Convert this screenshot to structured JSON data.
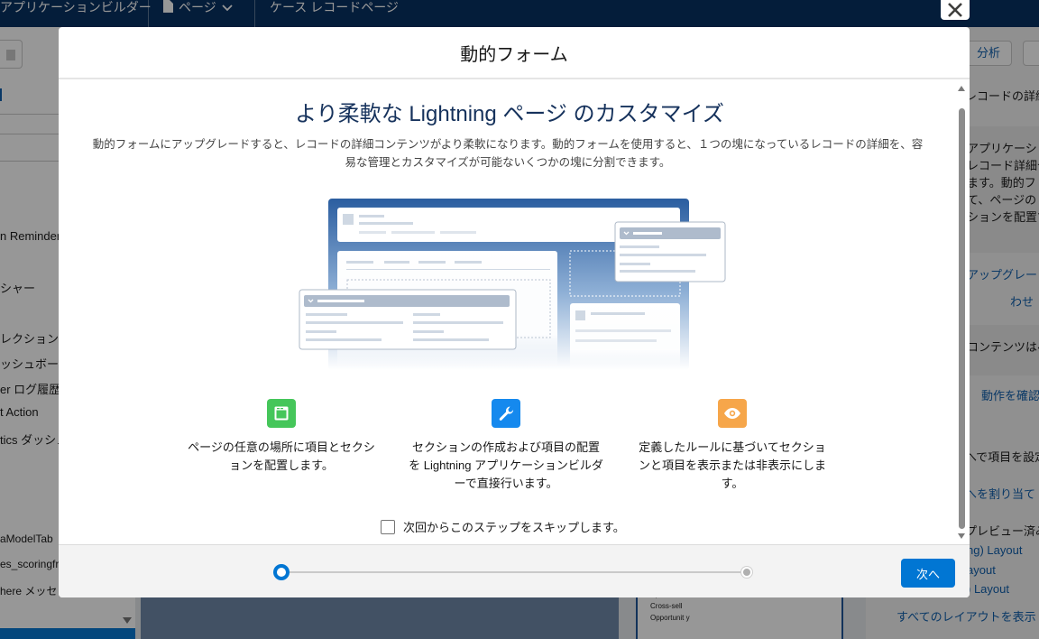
{
  "topbar": {
    "app_builder": "アプリケーションビルダー",
    "page_menu": "ページ",
    "page_name": "ケース レコードページ"
  },
  "left_panel": {
    "items": [
      "n Reminder",
      "シャー",
      "レクション",
      "ッシュボー",
      "er ログ履歴",
      "t Action",
      "tics ダッシュ",
      "aModelTab",
      "es_scoringfr",
      "here メッセ"
    ]
  },
  "right_panel": {
    "analyze_button": "分析",
    "record_detail": "レコードの詳細",
    "desc_lines": [
      "アプリケーシ",
      "レコード詳細セ",
      "ます。動的フ",
      "て、ページの",
      "ションを配置で"
    ],
    "upgrade_link": "アップグレードに関",
    "wase": "わせ",
    "content_text": "コンテンツはペー",
    "check_action": "動作を確認",
    "field_set": "へで項目を設定",
    "assign": "へを割り当て",
    "preview": "プレビュー済み",
    "layout1": "ng) Layout",
    "layout2": "ayout",
    "layout3": ") Layout",
    "all_layouts": "すべてのレイアウトを表示"
  },
  "canvas": {
    "card_text": "Up-sell / Cross-sell Opportunit y"
  },
  "modal": {
    "title": "動的フォーム",
    "headline": "より柔軟な Lightning ページ のカスタマイズ",
    "description": "動的フォームにアップグレードすると、レコードの詳細コンテンツがより柔軟になります。動的フォームを使用すると、１つの塊になっているレコードの詳細を、容易な管理とカスタマイズが可能ないくつかの塊に分割できます。",
    "features": [
      {
        "icon": "layout-icon",
        "color": "#45c65a",
        "text": "ページの任意の場所に項目とセクションを配置します。"
      },
      {
        "icon": "wrench-icon",
        "color": "#1589ee",
        "text": "セクションの作成および項目の配置を Lightning アプリケーションビルダーで直接行います。"
      },
      {
        "icon": "eye-icon",
        "color": "#f6a64a",
        "text": "定義したルールに基づいてセクションと項目を表示または非表示にします。"
      }
    ],
    "skip_label": "次回からこのステップをスキップします。",
    "skip_checked": false,
    "next_button": "次へ",
    "progress": {
      "current_step": 1,
      "total_steps": 2
    }
  },
  "colors": {
    "brand_navy": "#032d60",
    "primary_blue": "#0176d3",
    "headline_navy": "#16325c"
  }
}
